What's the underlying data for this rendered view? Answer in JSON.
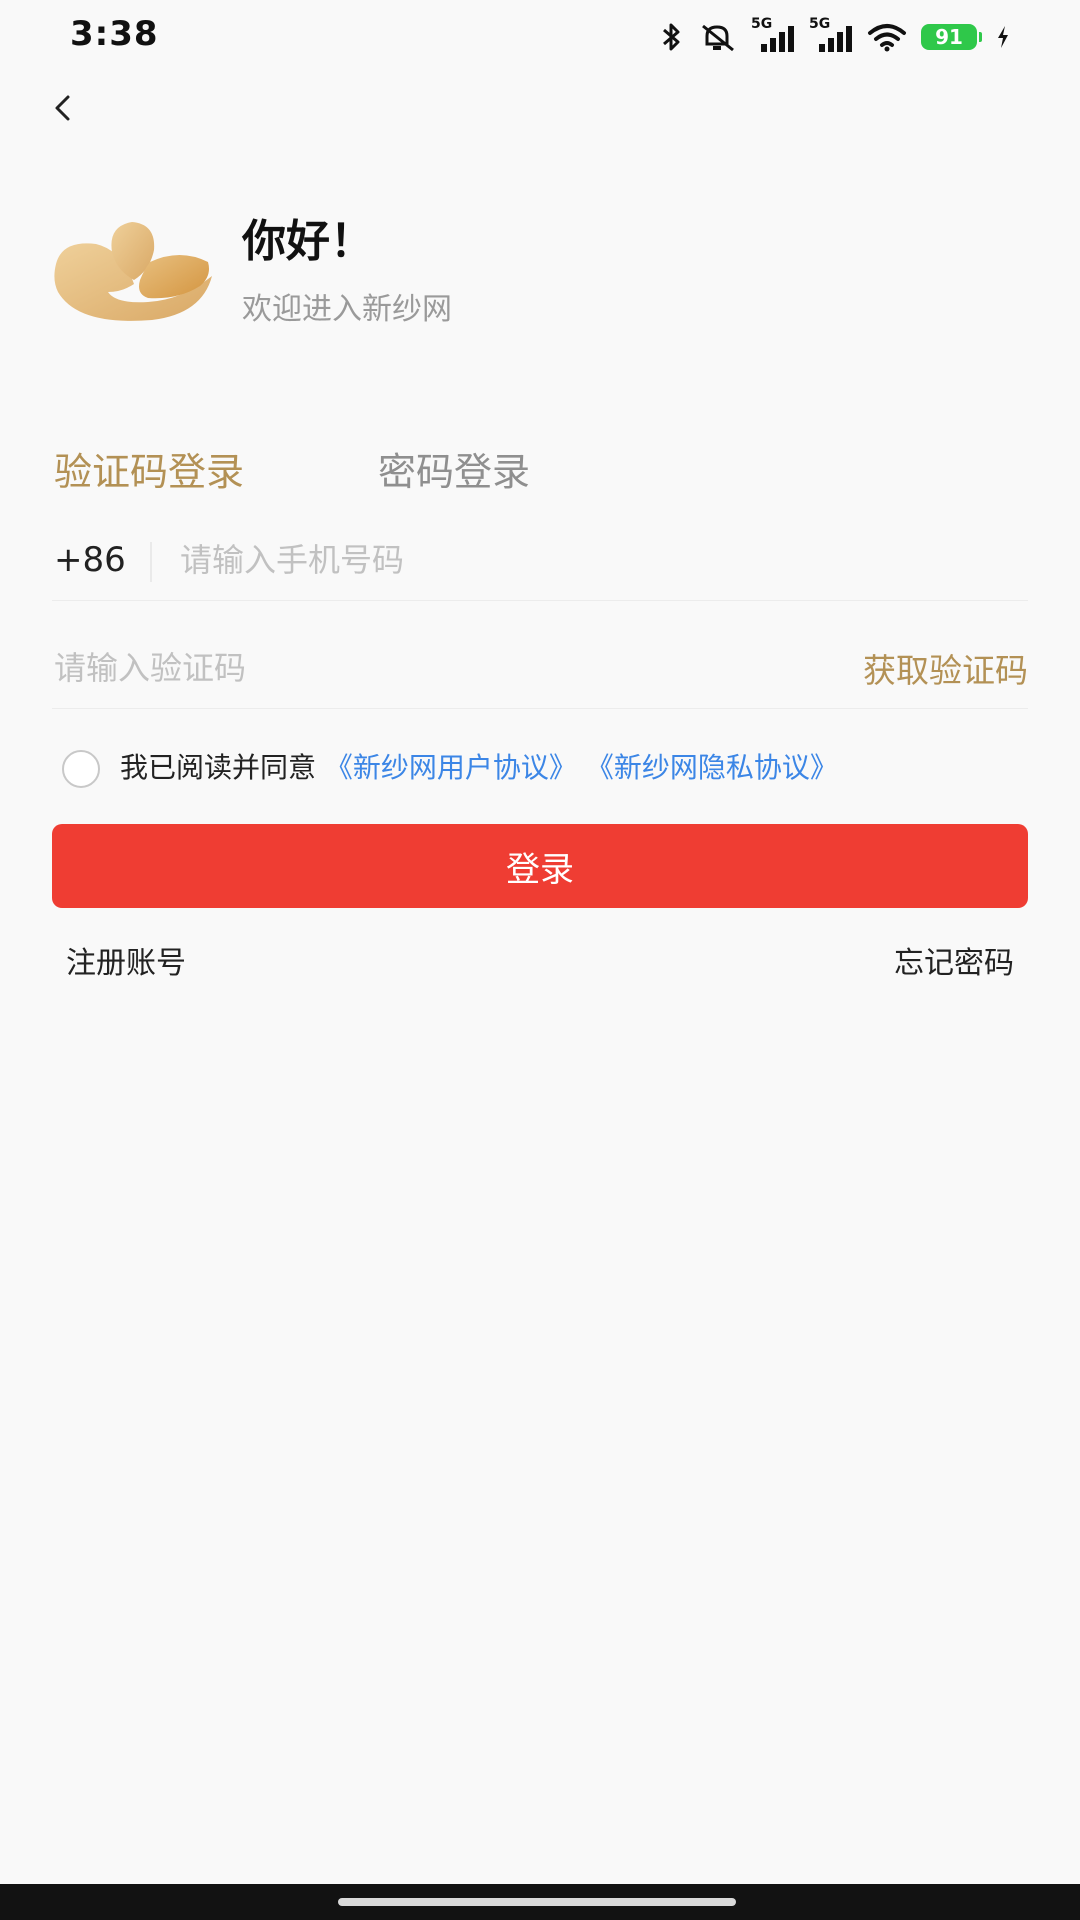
{
  "status_bar": {
    "time": "3:38",
    "battery": "91",
    "network_1": "5G",
    "network_2": "5G",
    "icons": [
      "bluetooth-icon",
      "mute-icon",
      "signal-5g-icon",
      "signal-5g-icon",
      "wifi-icon",
      "battery-icon",
      "charging-icon"
    ]
  },
  "header": {
    "greeting": "你好！",
    "welcome": "欢迎进入新纱网"
  },
  "tabs": [
    {
      "label": "验证码登录",
      "active": true
    },
    {
      "label": "密码登录",
      "active": false
    }
  ],
  "phone": {
    "country_code": "+86",
    "placeholder": "请输入手机号码",
    "value": ""
  },
  "code": {
    "placeholder": "请输入验证码",
    "value": "",
    "get_code_label": "获取验证码"
  },
  "agreement": {
    "prefix": "我已阅读并同意",
    "user_agreement": "《新纱网用户协议》",
    "privacy_agreement": "《新纱网隐私协议》",
    "checked": false
  },
  "login_button": "登录",
  "links": {
    "register": "注册账号",
    "forgot": "忘记密码"
  },
  "colors": {
    "accent_gold": "#b39155",
    "primary_red": "#ef3d33",
    "link_blue": "#3c86e6",
    "background": "#f9f9f9"
  }
}
